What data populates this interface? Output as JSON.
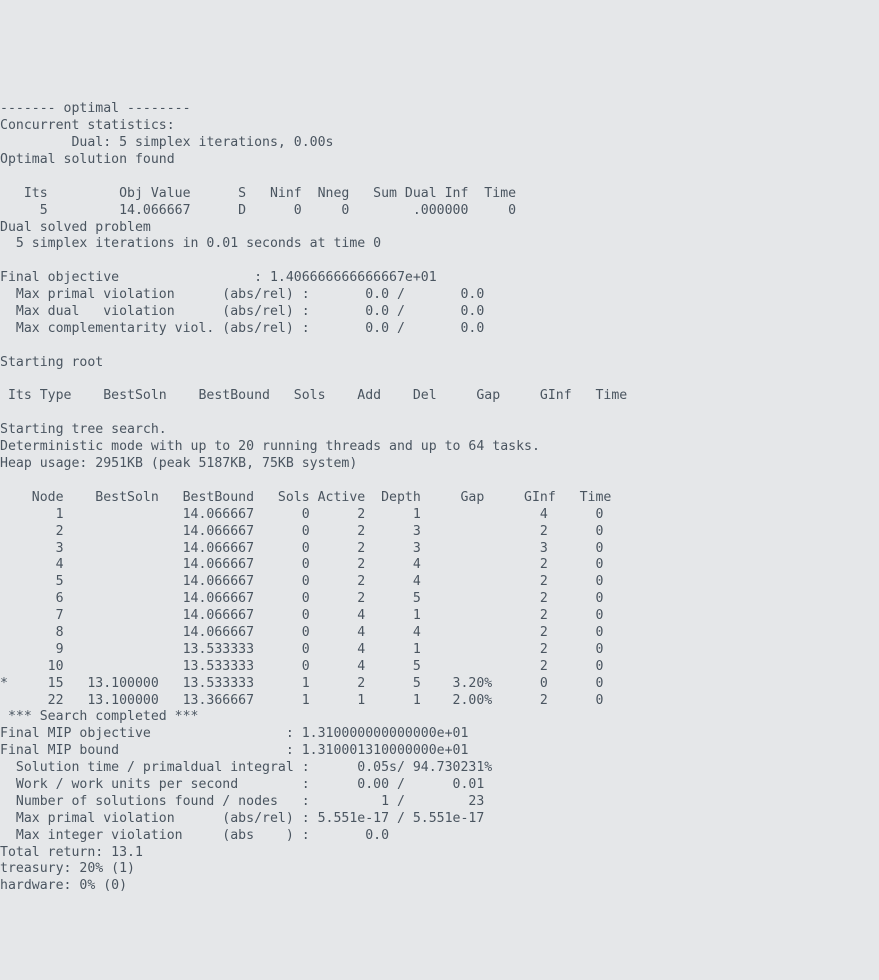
{
  "header": {
    "optimal_banner": "------- optimal --------",
    "conc_stats": "Concurrent statistics:",
    "dual_iter": "Dual: 5 simplex iterations, 0.00s",
    "opt_found": "Optimal solution found"
  },
  "its_table": {
    "header": "   Its         Obj Value      S   Ninf  Nneg   Sum Dual Inf  Time",
    "row1": "     5         14.066667      D      0     0        .000000     0"
  },
  "dual_solved": {
    "l1": "Dual solved problem",
    "l2": "  5 simplex iterations in 0.01 seconds at time 0"
  },
  "final_obj": {
    "l1": "Final objective                 : 1.406666666666667e+01",
    "l2": "  Max primal violation      (abs/rel) :       0.0 /       0.0",
    "l3": "  Max dual   violation      (abs/rel) :       0.0 /       0.0",
    "l4": "  Max complementarity viol. (abs/rel) :       0.0 /       0.0"
  },
  "root": {
    "starting": "Starting root",
    "header": " Its Type    BestSoln    BestBound   Sols    Add    Del     Gap     GInf   Time"
  },
  "tree": {
    "starting": "Starting tree search.",
    "mode": "Deterministic mode with up to 20 running threads and up to 64 tasks.",
    "heap": "Heap usage: 2951KB (peak 5187KB, 75KB system)",
    "header": "    Node    BestSoln   BestBound   Sols Active  Depth     Gap     GInf   Time",
    "rows": [
      "       1               14.066667      0      2      1               4      0",
      "       2               14.066667      0      2      3               2      0",
      "       3               14.066667      0      2      3               3      0",
      "       4               14.066667      0      2      4               2      0",
      "       5               14.066667      0      2      4               2      0",
      "       6               14.066667      0      2      5               2      0",
      "       7               14.066667      0      4      1               2      0",
      "       8               14.066667      0      4      4               2      0",
      "       9               13.533333      0      4      1               2      0",
      "      10               13.533333      0      4      5               2      0",
      "*     15   13.100000   13.533333      1      2      5    3.20%      0      0",
      "      22   13.100000   13.366667      1      1      1    2.00%      2      0"
    ],
    "completed": " *** Search completed ***"
  },
  "final_mip": {
    "l1": "Final MIP objective                 : 1.310000000000000e+01",
    "l2": "Final MIP bound                     : 1.310001310000000e+01",
    "l3": "  Solution time / primaldual integral :      0.05s/ 94.730231%",
    "l4": "  Work / work units per second        :      0.00 /      0.01",
    "l5": "  Number of solutions found / nodes   :         1 /        23",
    "l6": "  Max primal violation      (abs/rel) : 5.551e-17 / 5.551e-17",
    "l7": "  Max integer violation     (abs    ) :       0.0"
  },
  "results": {
    "total": "Total return: 13.1",
    "treasury": "treasury: 20% (1)",
    "hardware": "hardware: 0% (0)"
  }
}
